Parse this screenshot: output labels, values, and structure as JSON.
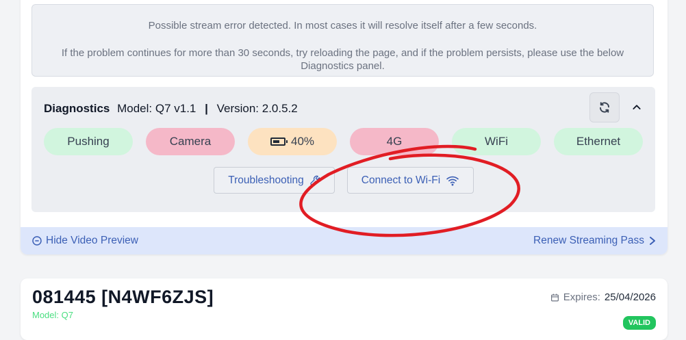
{
  "alert": {
    "line1": "Possible stream error detected. In most cases it will resolve itself after a few seconds.",
    "line2": "If the problem continues for more than 30 seconds, try reloading the page, and if the problem persists, please use the below Diagnostics panel."
  },
  "diagnostics": {
    "title": "Diagnostics",
    "model_label": "Model: Q7 v1.1",
    "separator": "|",
    "version_label": "Version: 2.0.5.2",
    "refresh_icon": "refresh-icon",
    "collapse_icon": "chevron-up-icon",
    "statuses": [
      {
        "label": "Pushing",
        "state": "ok",
        "color": "#d1f5de"
      },
      {
        "label": "Camera",
        "state": "error",
        "color": "#f5b8c8"
      },
      {
        "label": "40%",
        "state": "warning",
        "color": "#fde2c0",
        "icon": "battery-icon"
      },
      {
        "label": "4G",
        "state": "error",
        "color": "#f5b8c8"
      },
      {
        "label": "WiFi",
        "state": "ok",
        "color": "#d1f5de"
      },
      {
        "label": "Ethernet",
        "state": "ok",
        "color": "#d1f5de"
      }
    ],
    "troubleshooting_label": "Troubleshooting",
    "troubleshooting_icon": "wrench-icon",
    "connect_wifi_label": "Connect to Wi-Fi",
    "connect_wifi_icon": "wifi-icon"
  },
  "footer": {
    "hide_preview_label": "Hide Video Preview",
    "hide_preview_icon": "minus-circle-icon",
    "renew_label": "Renew Streaming Pass",
    "renew_icon": "chevron-right-icon"
  },
  "device": {
    "id_title": "081445 [N4WF6ZJS]",
    "model": "Model: Q7",
    "expires_label": "Expires:",
    "expires_date": "25/04/2026",
    "calendar_icon": "calendar-icon",
    "status_badge": "VALID"
  },
  "colors": {
    "accent": "#3b5fb5",
    "annotation": "#e11d24",
    "ok": "#d1f5de",
    "error": "#f5b8c8",
    "warning": "#fde2c0"
  }
}
